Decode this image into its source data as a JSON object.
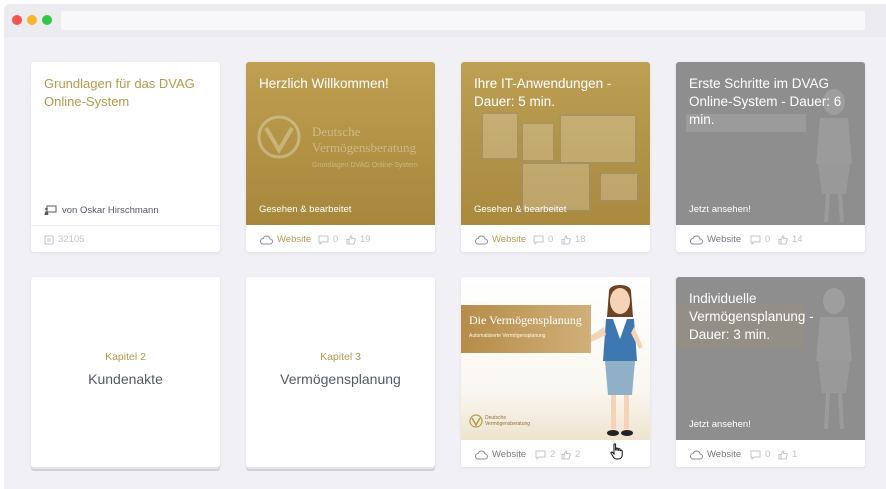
{
  "cards": {
    "course": {
      "title": "Grundlagen für das DVAG Online-System",
      "author": "von Oskar Hirschmann",
      "id": "32105"
    },
    "willkommen": {
      "title": "Herzlich Willkommen!",
      "status": "Gesehen & bearbeitet",
      "website": "Website",
      "comments": "0",
      "likes": "19",
      "logo_line1": "Deutsche",
      "logo_line2": "Vermögensberatung",
      "logo_line3": "Grundlagen DVAG Online-System"
    },
    "it_anwendungen": {
      "title": "Ihre IT-Anwendungen - Dauer: 5 min.",
      "status": "Gesehen & bearbeitet",
      "website": "Website",
      "comments": "0",
      "likes": "18"
    },
    "erste_schritte": {
      "title": "Erste Schritte im DVAG Online-System - Dauer: 6 min.",
      "status": "Jetzt ansehen!",
      "website": "Website",
      "comments": "0",
      "likes": "14"
    },
    "kapitel2": {
      "number": "Kapitel 2",
      "name": "Kundenakte"
    },
    "kapitel3": {
      "number": "Kapitel 3",
      "name": "Vermögensplanung"
    },
    "vermoegensplanung": {
      "banner_title": "Die Vermögensplanung",
      "banner_sub": "Automatisierte Vermögensplanung",
      "logo_line1": "Deutsche",
      "logo_line2": "Vermögensberatung",
      "website": "Website",
      "comments": "2",
      "likes": "2"
    },
    "individuelle": {
      "title": "Individuelle Vermögensplanung - Dauer: 3 min.",
      "status": "Jetzt ansehen!",
      "website": "Website",
      "comments": "0",
      "likes": "1"
    }
  },
  "colors": {
    "accent_gold": "#b69a4e",
    "thumb_grey": "#8e8e8e",
    "background": "#f0f0f5"
  },
  "icons": [
    "cloud-icon",
    "comment-icon",
    "thumbs-up-icon",
    "presenter-icon",
    "id-card-icon",
    "hand-cursor-icon"
  ]
}
